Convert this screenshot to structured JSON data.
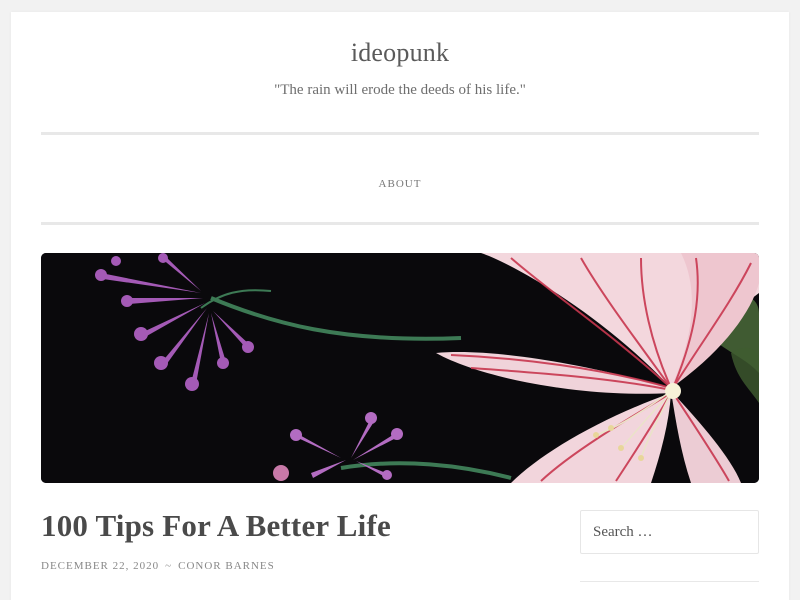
{
  "site": {
    "title": "ideopunk",
    "description": "\"The rain will erode the deeds of his life.\""
  },
  "menu": {
    "items": [
      {
        "label": "About"
      }
    ]
  },
  "header_image": {
    "subject": "pink striped lily and purple flowers on black background",
    "colors": {
      "background": "#0a090c",
      "lily": "#f3d7dd",
      "lily_stripe": "#c8374f",
      "purple": "#a45ab6",
      "stem": "#3d7a55"
    }
  },
  "post": {
    "title": "100 Tips For A Better Life",
    "date": "December 22, 2020",
    "separator": "~",
    "author": "Conor Barnes"
  },
  "sidebar": {
    "search": {
      "placeholder": "Search …"
    }
  }
}
